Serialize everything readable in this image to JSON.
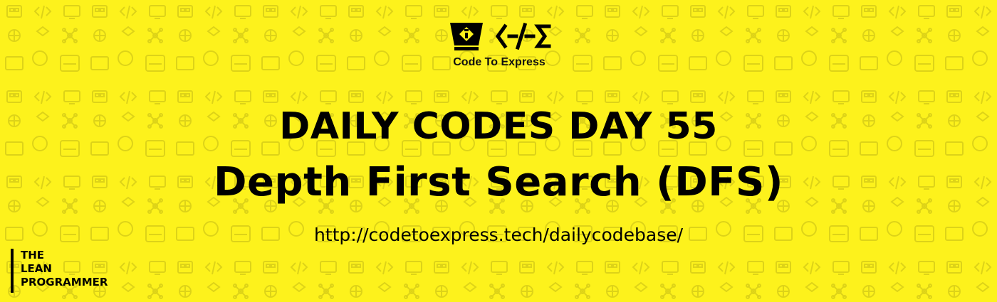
{
  "brand": {
    "name": "Code To Express",
    "glyph": "<-/-Σ",
    "mark_icon": "monitor-diamond-icon"
  },
  "headline": {
    "line1": "DAILY CODES DAY 55",
    "line2": "Depth First Search (DFS)"
  },
  "url": "http://codetoexpress.tech/dailycodebase/",
  "badge": {
    "line1": "THE",
    "line2": "LEAN",
    "line3": "PROGRAMMER"
  },
  "colors": {
    "background": "#fdf21c",
    "text": "#000000"
  },
  "pattern_icons": [
    "chip-icon",
    "code-icon",
    "monitor-icon",
    "x86-icon",
    "brain-icon",
    "network-icon",
    "cpp-icon",
    "csharp-icon",
    "pill-icon",
    "car-icon",
    "cloud-dollar-icon"
  ]
}
